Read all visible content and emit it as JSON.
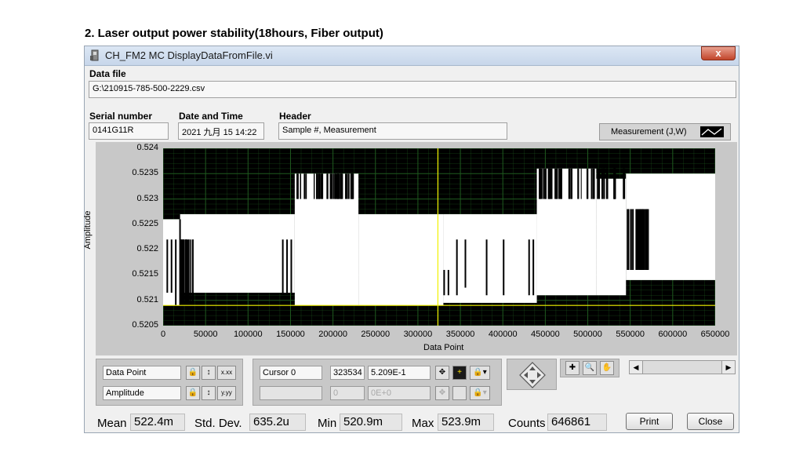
{
  "heading": "2.   Laser output power stability(18hours, Fiber output)",
  "window": {
    "title": "CH_FM2 MC DisplayDataFromFile.vi",
    "close_label": "x"
  },
  "data_file": {
    "label": "Data file",
    "value": "G:\\210915-785-500-2229.csv"
  },
  "serial": {
    "label": "Serial number",
    "value": "0141G11R"
  },
  "datetime": {
    "label": "Date and Time",
    "value": "2021 九月 15 14:22"
  },
  "header": {
    "label": "Header",
    "value": "Sample #, Measurement"
  },
  "legend": {
    "label": "Measurement (J,W)"
  },
  "chart_data": {
    "type": "line",
    "xlabel": "Data Point",
    "ylabel": "Amplitude",
    "xlim": [
      0,
      650000
    ],
    "ylim": [
      0.5205,
      0.524
    ],
    "x_ticks": [
      "0",
      "50000",
      "100000",
      "150000",
      "200000",
      "250000",
      "300000",
      "350000",
      "400000",
      "450000",
      "500000",
      "550000",
      "600000",
      "650000"
    ],
    "y_ticks": [
      "0.524",
      "0.5235",
      "0.523",
      "0.5225",
      "0.522",
      "0.5215",
      "0.521",
      "0.5205"
    ],
    "cursor": {
      "x": 323534,
      "y": 0.5209
    },
    "grid": true,
    "colors": {
      "background": "#000000",
      "trace": "#ffffff",
      "grid": "#1f5a1f",
      "cursor": "#f2f200"
    }
  },
  "scale_controls": {
    "x_name": "Data Point",
    "y_name": "Amplitude",
    "x_fmt": "x.xx",
    "y_fmt": "y.yy"
  },
  "cursor_panel": {
    "name": "Cursor 0",
    "x": "323534",
    "y": "5.209E-1",
    "x2": "0",
    "y2": "0E+0"
  },
  "stats": {
    "mean_label": "Mean",
    "mean": "522.4m",
    "std_label": "Std. Dev.",
    "std": "635.2u",
    "min_label": "Min",
    "min": "520.9m",
    "max_label": "Max",
    "max": "523.9m",
    "counts_label": "Counts",
    "counts": "646861"
  },
  "buttons": {
    "print": "Print",
    "close": "Close"
  }
}
